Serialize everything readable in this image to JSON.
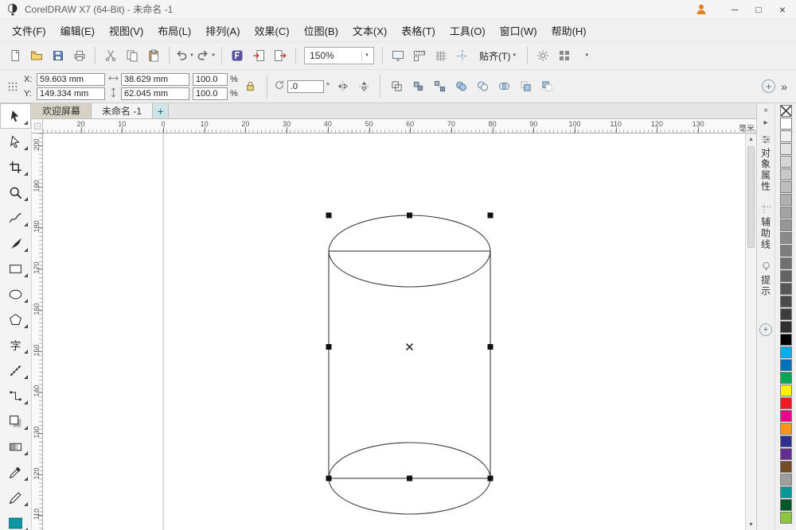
{
  "window": {
    "title": "CorelDRAW X7 (64-Bit) - 未命名 -1",
    "controls": {
      "minimize": "─",
      "maximize": "□",
      "close": "×"
    }
  },
  "menu": {
    "items": [
      {
        "id": "file",
        "label": "文件(F)"
      },
      {
        "id": "edit",
        "label": "编辑(E)"
      },
      {
        "id": "view",
        "label": "视图(V)"
      },
      {
        "id": "layout",
        "label": "布局(L)"
      },
      {
        "id": "arrange",
        "label": "排列(A)"
      },
      {
        "id": "effects",
        "label": "效果(C)"
      },
      {
        "id": "bitmaps",
        "label": "位图(B)"
      },
      {
        "id": "text",
        "label": "文本(X)"
      },
      {
        "id": "table",
        "label": "表格(T)"
      },
      {
        "id": "tools",
        "label": "工具(O)"
      },
      {
        "id": "window",
        "label": "窗口(W)"
      },
      {
        "id": "help",
        "label": "帮助(H)"
      }
    ]
  },
  "toolbar": {
    "zoom_value": "150%",
    "snap_label": "贴齐(T)",
    "items": [
      {
        "type": "button",
        "id": "new-document",
        "icon": "new"
      },
      {
        "type": "button",
        "id": "open",
        "icon": "open"
      },
      {
        "type": "button",
        "id": "save",
        "icon": "save"
      },
      {
        "type": "button",
        "id": "print",
        "icon": "print"
      },
      {
        "type": "sep"
      },
      {
        "type": "button",
        "id": "cut",
        "icon": "cut"
      },
      {
        "type": "button",
        "id": "copy",
        "icon": "copy"
      },
      {
        "type": "button",
        "id": "paste",
        "icon": "paste"
      },
      {
        "type": "sep"
      },
      {
        "type": "button",
        "id": "undo",
        "icon": "undo",
        "dropdown": true
      },
      {
        "type": "button",
        "id": "redo",
        "icon": "redo",
        "dropdown": true
      },
      {
        "type": "sep"
      },
      {
        "type": "button",
        "id": "search-content",
        "icon": "search"
      },
      {
        "type": "button",
        "id": "import",
        "icon": "import"
      },
      {
        "type": "button",
        "id": "export",
        "icon": "export"
      },
      {
        "type": "sep"
      },
      {
        "type": "zoom"
      },
      {
        "type": "sep"
      },
      {
        "type": "button",
        "id": "fullscreen-preview",
        "icon": "fullscreen"
      },
      {
        "type": "button",
        "id": "show-rulers",
        "icon": "rulers"
      },
      {
        "type": "button",
        "id": "show-grid",
        "icon": "grid"
      },
      {
        "type": "button",
        "id": "show-guidelines",
        "icon": "guidelines"
      },
      {
        "type": "snap"
      },
      {
        "type": "sep"
      },
      {
        "type": "button",
        "id": "options",
        "icon": "options"
      },
      {
        "type": "button",
        "id": "application-launcher",
        "icon": "launcher"
      },
      {
        "type": "overflow"
      }
    ]
  },
  "property_bar": {
    "x_label": "X:",
    "x_value": "59.603 mm",
    "y_label": "Y:",
    "y_value": "149.334 mm",
    "width_value": "38.629 mm",
    "height_value": "62.045 mm",
    "scale_x_value": "100.0",
    "scale_y_value": "100.0",
    "percent_label": "%",
    "rotation_value": ".0",
    "degree_label": "°",
    "overflow_label": "»",
    "quick_customize_label": "+",
    "mirror_buttons": [
      {
        "id": "mirror-horizontal",
        "icon": "mirror-h"
      },
      {
        "id": "mirror-vertical",
        "icon": "mirror-v"
      }
    ],
    "arrange_buttons": [
      {
        "id": "combine",
        "icon": "combine"
      },
      {
        "id": "group-objects",
        "icon": "group"
      },
      {
        "id": "ungroup-objects",
        "icon": "ungroup"
      },
      {
        "id": "weld",
        "icon": "weld"
      },
      {
        "id": "trim",
        "icon": "trim"
      },
      {
        "id": "intersect",
        "icon": "intersect"
      },
      {
        "id": "front-minus-back",
        "icon": "front-minus-back"
      },
      {
        "id": "back-minus-front",
        "icon": "back-minus-front"
      }
    ]
  },
  "document_tabs": {
    "tabs": [
      {
        "id": "welcome",
        "label": "欢迎屏幕",
        "active": false
      },
      {
        "id": "untitled-1",
        "label": "未命名 -1",
        "active": true
      }
    ],
    "new_tab_label": "+"
  },
  "rulers": {
    "unit_label": "毫米",
    "horizontal_labels": [
      "20",
      "10",
      "0",
      "10",
      "20",
      "30",
      "40",
      "50",
      "60",
      "70",
      "80",
      "90",
      "100",
      "110",
      "120",
      "130"
    ],
    "vertical_labels": [
      "200",
      "190",
      "180",
      "170",
      "160",
      "150",
      "140",
      "130",
      "120",
      "110"
    ]
  },
  "toolbox": {
    "tools": [
      {
        "id": "pick",
        "icon": "pick",
        "active": true
      },
      {
        "id": "shape",
        "icon": "shape"
      },
      {
        "id": "crop",
        "icon": "crop"
      },
      {
        "id": "zoom",
        "icon": "zoom"
      },
      {
        "id": "freehand",
        "icon": "freehand"
      },
      {
        "id": "artistic-media",
        "icon": "artistic-media"
      },
      {
        "id": "rectangle",
        "icon": "rectangle"
      },
      {
        "id": "ellipse",
        "icon": "ellipse"
      },
      {
        "id": "polygon",
        "icon": "polygon"
      },
      {
        "id": "text",
        "icon": "text"
      },
      {
        "id": "parallel-dimension",
        "icon": "dimension"
      },
      {
        "id": "straight-line-connector",
        "icon": "connector"
      },
      {
        "id": "drop-shadow",
        "icon": "drop-shadow"
      },
      {
        "id": "transparency",
        "icon": "transparency"
      },
      {
        "id": "color-eyedropper",
        "icon": "eyedropper"
      },
      {
        "id": "outline-pen",
        "icon": "outline-pen"
      },
      {
        "id": "interactive-fill",
        "icon": "interactive-fill"
      }
    ]
  },
  "canvas": {
    "object_type": "cylinder",
    "selection": {
      "handle_count": 8,
      "center_mark": "×"
    }
  },
  "dockers": {
    "close_glyph": "×",
    "collapse_glyph": "▸",
    "quick_customize_label": "+",
    "tabs": [
      {
        "id": "object-properties",
        "label": "对象属性",
        "icon": "object-properties"
      },
      {
        "id": "guidelines",
        "label": "辅助线",
        "icon": "guidelines-docker"
      },
      {
        "id": "hints",
        "label": "提示",
        "icon": "hints"
      }
    ]
  },
  "palette": {
    "colors": [
      "none",
      "#FFFFFF",
      "#F0F0F0",
      "#E3E3E3",
      "#D6D6D6",
      "#C9C9C9",
      "#BDBDBD",
      "#B0B0B0",
      "#A3A3A3",
      "#969696",
      "#8A8A8A",
      "#7D7D7D",
      "#707070",
      "#636363",
      "#575757",
      "#4A4A4A",
      "#3D3D3D",
      "#303030",
      "#000000",
      "#00AEEF",
      "#0072BC",
      "#00A651",
      "#FFF200",
      "#ED1C24",
      "#EC008C",
      "#F7941D",
      "#2E3192",
      "#662D91",
      "#754C24",
      "#9E9E9E",
      "#00999B",
      "#005826",
      "#8DC63F"
    ]
  },
  "scrollbar": {
    "up_glyph": "▲",
    "down_glyph": "▼"
  }
}
